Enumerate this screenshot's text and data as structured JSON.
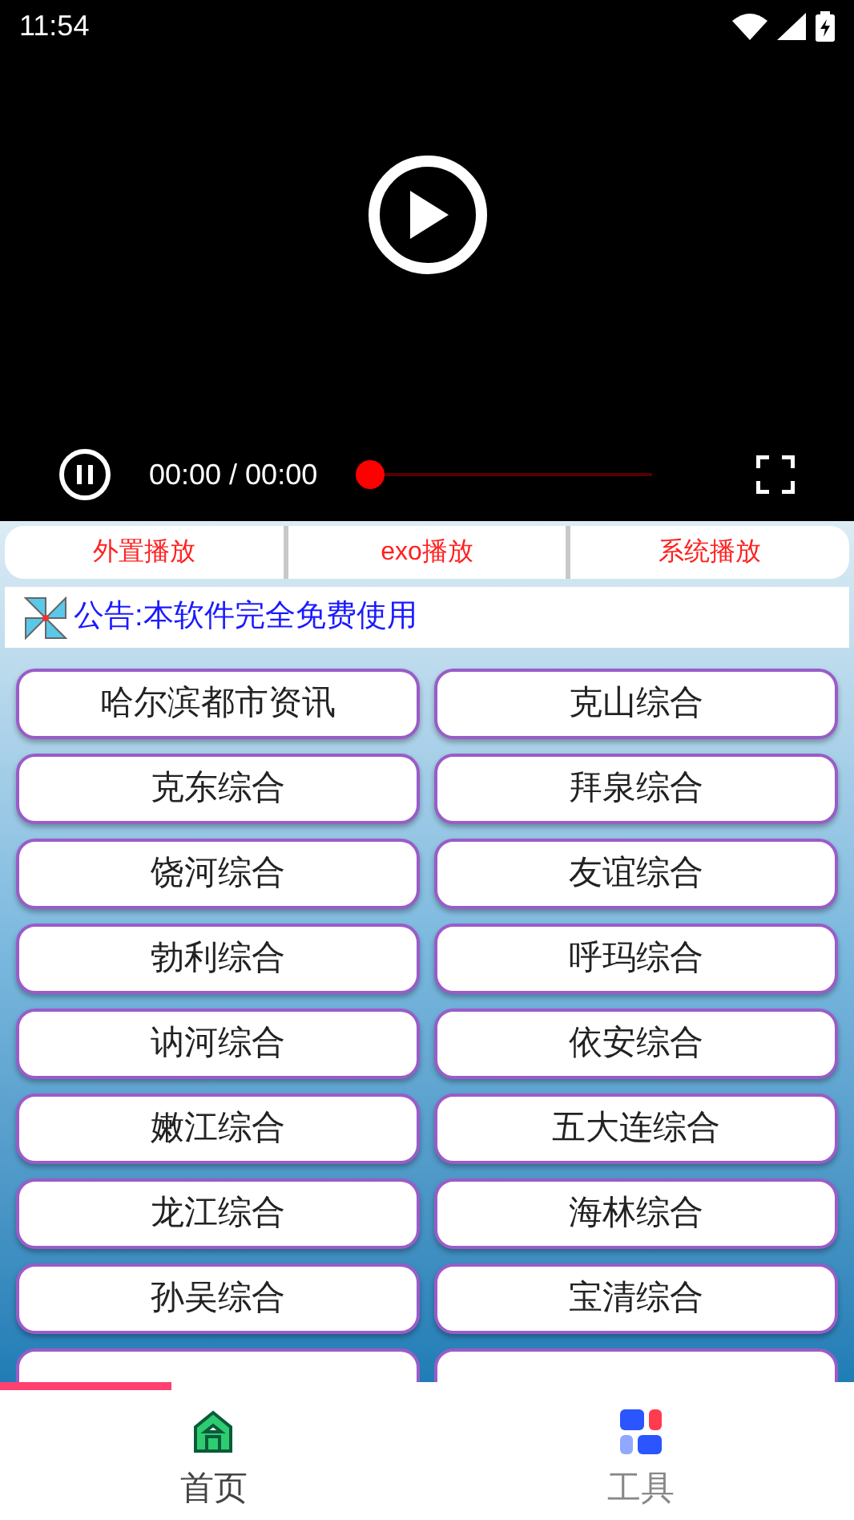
{
  "status_bar": {
    "time": "11:54"
  },
  "player": {
    "position": "00:00 / 00:00",
    "level": 0
  },
  "player_options": [
    "外置播放",
    "exo播放",
    "系统播放"
  ],
  "notice": "公告:本软件完全免费使用",
  "stations": [
    {
      "label": "哈尔滨都市资讯"
    },
    {
      "label": "克山综合"
    },
    {
      "label": "克东综合"
    },
    {
      "label": "拜泉综合"
    },
    {
      "label": "饶河综合"
    },
    {
      "label": "友谊综合"
    },
    {
      "label": "勃利综合"
    },
    {
      "label": "呼玛综合"
    },
    {
      "label": "讷河综合"
    },
    {
      "label": "依安综合"
    },
    {
      "label": "嫩江综合"
    },
    {
      "label": "五大连综合"
    },
    {
      "label": "龙江综合"
    },
    {
      "label": "海林综合"
    },
    {
      "label": "孙吴综合"
    },
    {
      "label": "宝清综合"
    },
    {
      "kind": "cut_off"
    },
    {
      "kind": "cut_off"
    }
  ],
  "loading": {
    "level": 0.2
  },
  "bottom_nav": [
    {
      "label": "首页",
      "kind": "home",
      "selected": true
    },
    {
      "label": "工具",
      "kind": "tools",
      "selected": false
    }
  ]
}
